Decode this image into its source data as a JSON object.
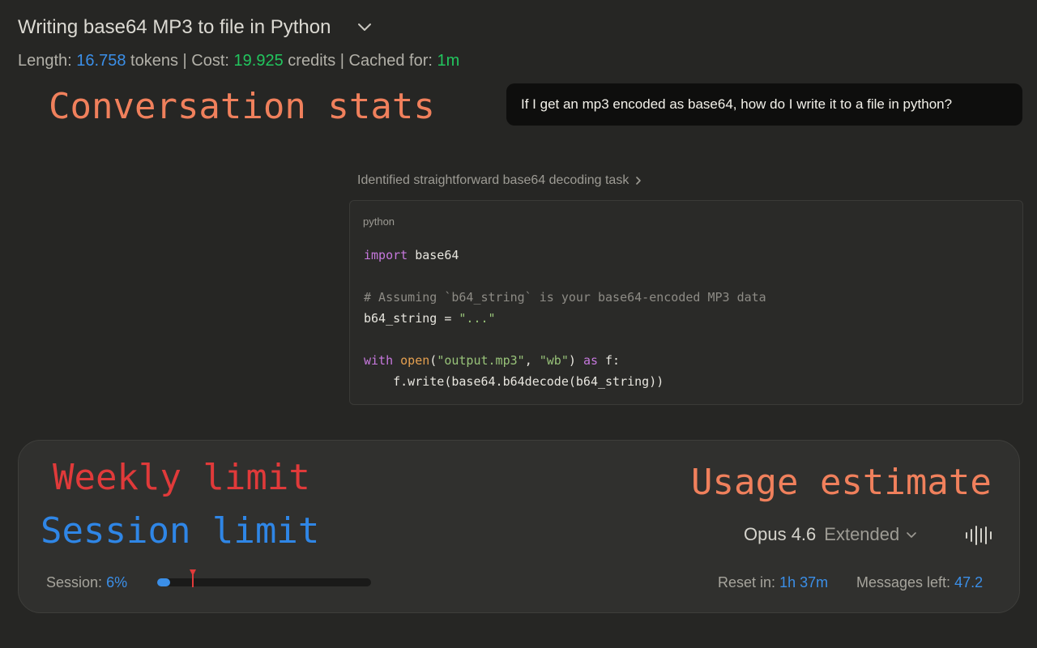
{
  "header": {
    "title": "Writing base64 MP3 to file in Python",
    "stats": {
      "length_label": "Length:",
      "length_value": "16.758",
      "length_unit": "tokens",
      "sep1": "|",
      "cost_label": "Cost:",
      "cost_value": "19.925",
      "cost_unit": "credits",
      "sep2": "|",
      "cached_label": "Cached for:",
      "cached_value": "1m"
    }
  },
  "annotations": {
    "conversation_stats": "Conversation stats",
    "weekly_limit": "Weekly limit",
    "session_limit": "Session limit",
    "usage_estimate": "Usage estimate"
  },
  "conversation": {
    "user_message": "If I get an mp3 encoded as base64, how do I write it to a file in python?",
    "thinking_summary": "Identified straightforward base64 decoding task",
    "code_block": {
      "language": "python",
      "lines": {
        "l1_kw": "import",
        "l1_rest": " base64",
        "l3_comment": "# Assuming `b64_string` is your base64-encoded MP3 data",
        "l4_var": "b64_string = ",
        "l4_str": "\"...\"",
        "l6_kw_with": "with",
        "l6_fn_open": "open",
        "l6_paren": "(",
        "l6_str1": "\"output.mp3\"",
        "l6_comma": ", ",
        "l6_str2": "\"wb\"",
        "l6_close": ") ",
        "l6_kw_as": "as",
        "l6_tail": " f:",
        "l7": "    f.write(base64.b64decode(b64_string))"
      }
    }
  },
  "composer": {
    "model_name": "Opus 4.6",
    "model_mode": "Extended",
    "session_label": "Session:",
    "session_value": "6%",
    "session_fraction": 0.06,
    "weekly_marker_fraction": 0.165,
    "reset_label": "Reset in:",
    "reset_value": "1h 37m",
    "messages_label": "Messages left:",
    "messages_value": "47.2"
  },
  "icons": {
    "title_dropdown": "chevron-down-icon",
    "thinking_expand": "chevron-right-icon",
    "model_dropdown": "chevron-down-icon",
    "voice": "audio-waveform-icon",
    "weekly_marker": "triangle-marker-icon"
  },
  "colors": {
    "accent_blue": "#3b8fe8",
    "accent_green": "#22c55e",
    "annotation_orange": "#f0805c",
    "annotation_red": "#e03a3a",
    "annotation_blue": "#2f86e6"
  }
}
